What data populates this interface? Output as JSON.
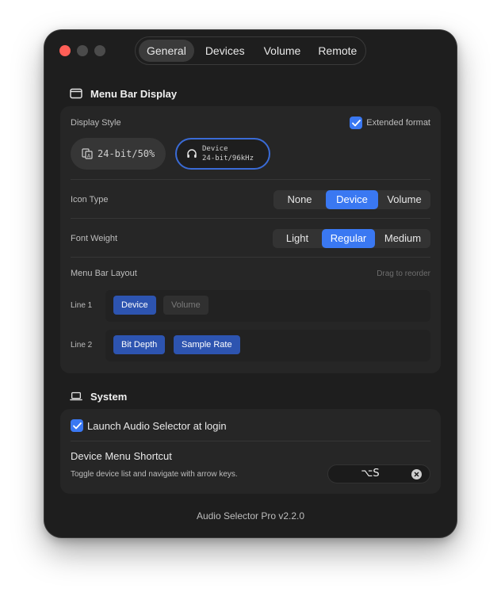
{
  "window": {
    "tabs": [
      "General",
      "Devices",
      "Volume",
      "Remote"
    ],
    "active_tab": "General"
  },
  "menu_bar_display": {
    "title": "Menu Bar Display",
    "display_style_label": "Display Style",
    "extended_format_label": "Extended format",
    "extended_format_checked": true,
    "preview_compact_text": "24-bit/50%",
    "preview_extended_line1": "Device",
    "preview_extended_line2": "24-bit/96kHz",
    "icon_type_label": "Icon Type",
    "icon_type_options": [
      "None",
      "Device",
      "Volume"
    ],
    "icon_type_selected": "Device",
    "font_weight_label": "Font Weight",
    "font_weight_options": [
      "Light",
      "Regular",
      "Medium"
    ],
    "font_weight_selected": "Regular",
    "layout_label": "Menu Bar Layout",
    "layout_hint": "Drag to reorder",
    "line1_label": "Line 1",
    "line1_items": [
      "Device",
      "Volume"
    ],
    "line2_label": "Line 2",
    "line2_items": [
      "Bit Depth",
      "Sample Rate"
    ]
  },
  "system": {
    "title": "System",
    "launch_at_login_label": "Launch Audio Selector at login",
    "launch_at_login_checked": true,
    "shortcut_title": "Device Menu Shortcut",
    "shortcut_description": "Toggle device list and navigate with arrow keys.",
    "shortcut_value": "⌥S"
  },
  "footer": {
    "version": "Audio Selector Pro v2.2.0"
  },
  "colors": {
    "accent": "#3a78f2",
    "chip_active": "#2d54b0",
    "close": "#ff5f57"
  }
}
